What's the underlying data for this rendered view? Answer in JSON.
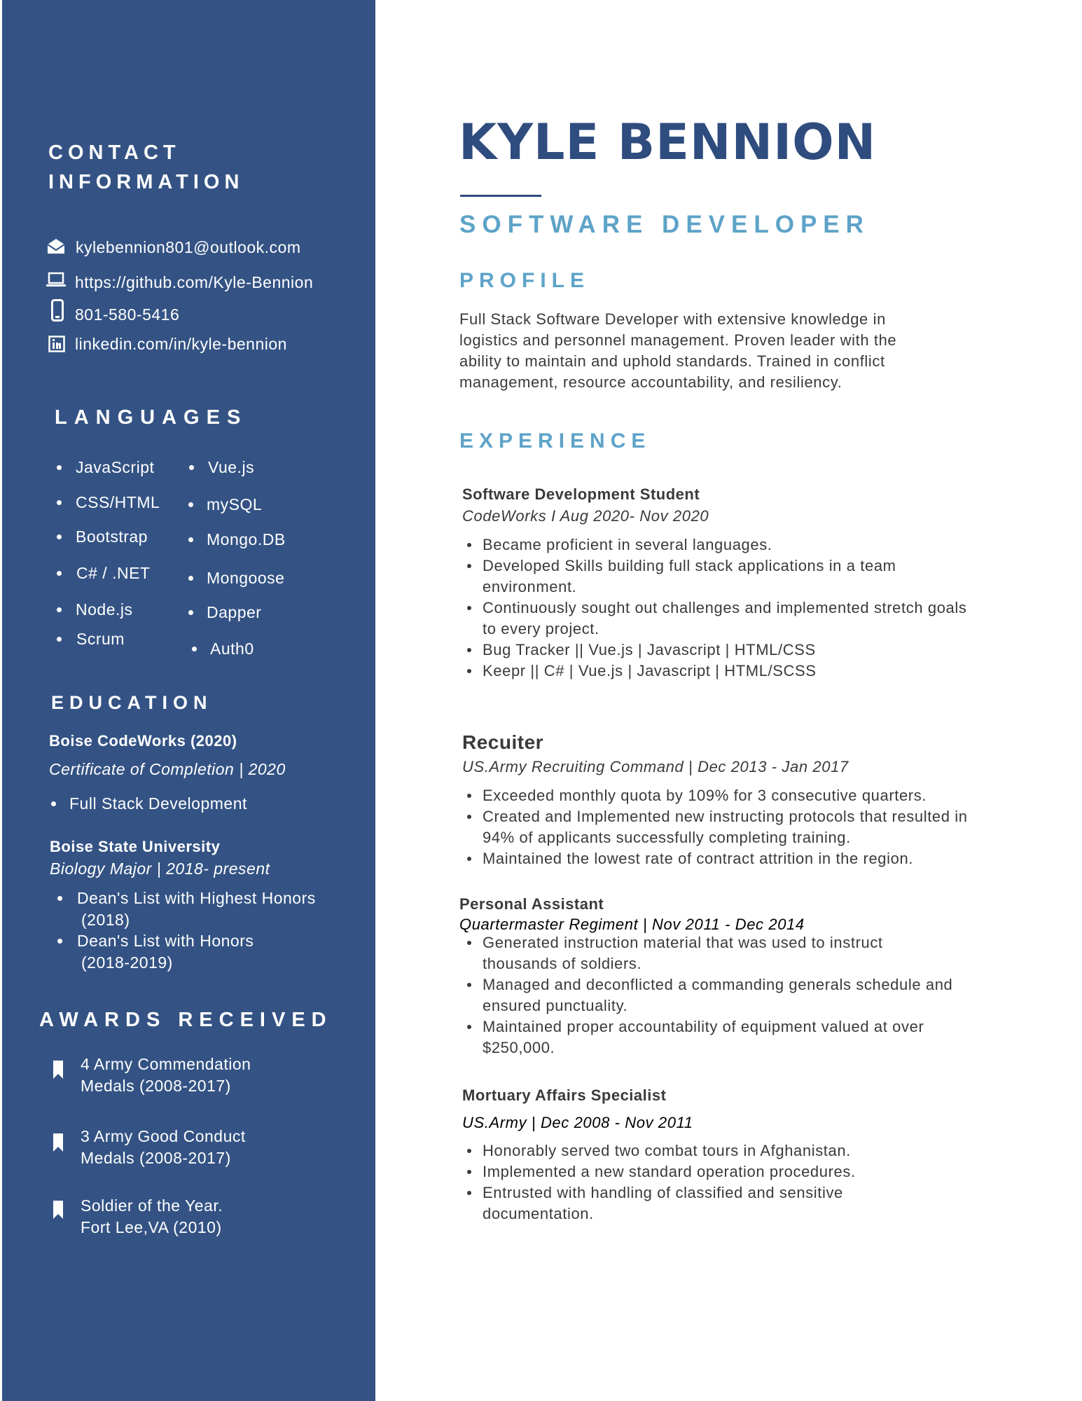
{
  "sidebar": {
    "contact": {
      "heading_line1": "CONTACT",
      "heading_line2": "INFORMATION",
      "email": "kylebennion801@outlook.com",
      "github": "https://github.com/Kyle-Bennion",
      "phone": "801-580-5416",
      "linkedin": "linkedin.com/in/kyle-bennion",
      "icons": [
        "envelope-icon",
        "laptop-icon",
        "phone-icon",
        "linkedin-icon"
      ]
    },
    "languages": {
      "heading": "LANGUAGES",
      "col1": [
        "JavaScript",
        "CSS/HTML",
        "Bootstrap",
        "C# / .NET",
        "Node.js",
        "Scrum"
      ],
      "col2": [
        "Vue.js",
        "mySQL",
        "Mongo.DB",
        "Mongoose",
        "Dapper",
        "Auth0"
      ]
    },
    "education": {
      "heading": "EDUCATION",
      "school1": "Boise CodeWorks (2020)",
      "school1_detail": "Certificate of Completion | 2020",
      "school1_bullet": "Full Stack Development",
      "school2": "Boise State University",
      "school2_detail": "Biology Major | 2018- present",
      "school2_bullet1_line1": "Dean's List with Highest Honors",
      "school2_bullet1_line2": "(2018)",
      "school2_bullet2_line1": "Dean's List with Honors",
      "school2_bullet2_line2": "(2018-2019)"
    },
    "awards": {
      "heading": "AWARDS RECEIVED",
      "icon": "bookmark-icon",
      "items": [
        {
          "line1": "4 Army Commendation",
          "line2": "Medals (2008-2017)"
        },
        {
          "line1": "3 Army Good Conduct",
          "line2": "Medals (2008-2017)"
        },
        {
          "line1": "Soldier of the Year.",
          "line2": "Fort Lee,VA (2010)"
        }
      ]
    }
  },
  "main": {
    "name": "KYLE BENNION",
    "title": "SOFTWARE DEVELOPER",
    "profile_heading": "PROFILE",
    "profile_lines": [
      "Full Stack Software Developer with extensive knowledge in",
      "logistics and personnel management. Proven leader with the",
      "ability to maintain and uphold standards. Trained in conflict",
      "management, resource accountability, and resiliency."
    ],
    "experience_heading": "EXPERIENCE",
    "jobs": [
      {
        "title": "Software Development Student",
        "meta": "CodeWorks  I  Aug 2020- Nov 2020",
        "bullets": [
          "Became proficient in several languages.",
          "Developed Skills building full stack applications in a team environment.",
          "Continuously sought out challenges and implemented stretch goals to every project.",
          "Bug Tracker || Vue.js | Javascript | HTML/CSS",
          "Keepr || C# | Vue.js | Javascript | HTML/SCSS"
        ]
      },
      {
        "title": "Recuiter",
        "meta": "US.Army Recruiting Command  | Dec 2013 - Jan 2017",
        "bullets": [
          "Exceeded monthly quota by 109% for 3 consecutive quarters.",
          "Created and Implemented new instructing protocols that resulted in 94% of applicants successfully completing training.",
          "Maintained the lowest rate of contract attrition in the region."
        ]
      },
      {
        "title": "Personal Assistant",
        "meta": "Quartermaster Regiment | Nov 2011 - Dec 2014",
        "bullets": [
          "Generated instruction material that was used to instruct thousands of soldiers.",
          "Managed and deconflicted a commanding generals schedule and ensured punctuality.",
          "Maintained proper accountability of equipment valued at over $250,000."
        ]
      },
      {
        "title": "Mortuary Affairs Specialist",
        "meta": "US.Army   | Dec 2008 - Nov 2011",
        "bullets": [
          "Honorably served two combat tours in Afghanistan.",
          "Implemented a new standard operation procedures.",
          "Entrusted with handling of classified and sensitive documentation."
        ]
      }
    ]
  },
  "colors": {
    "sidebar": "#345384",
    "name": "#2f4c7e",
    "accent": "#5ea3c8",
    "body_text": "#3a3a3a"
  }
}
